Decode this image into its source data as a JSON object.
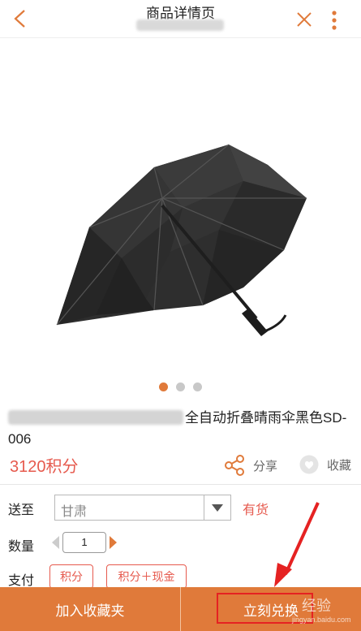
{
  "header": {
    "title": "商品详情页"
  },
  "carousel": {
    "active_index": 0,
    "count": 3
  },
  "product": {
    "name_suffix": "全自动折叠晴雨伞黑色SD-006",
    "price": "3120积分"
  },
  "actions": {
    "share_label": "分享",
    "favorite_label": "收藏"
  },
  "delivery": {
    "label": "送至",
    "region": "甘肃",
    "stock": "有货"
  },
  "quantity": {
    "label": "数量",
    "value": "1"
  },
  "payment": {
    "label": "支付",
    "options": [
      "积分",
      "积分＋现金"
    ]
  },
  "bottom_bar": {
    "add_to_favorites": "加入收藏夹",
    "buy_now": "立刻兑换"
  },
  "watermark": {
    "text": "经验",
    "subtext": "jingyan.baidu.com"
  },
  "colors": {
    "accent": "#e07a3a",
    "price": "#e65a4e",
    "highlight": "#e52222"
  }
}
